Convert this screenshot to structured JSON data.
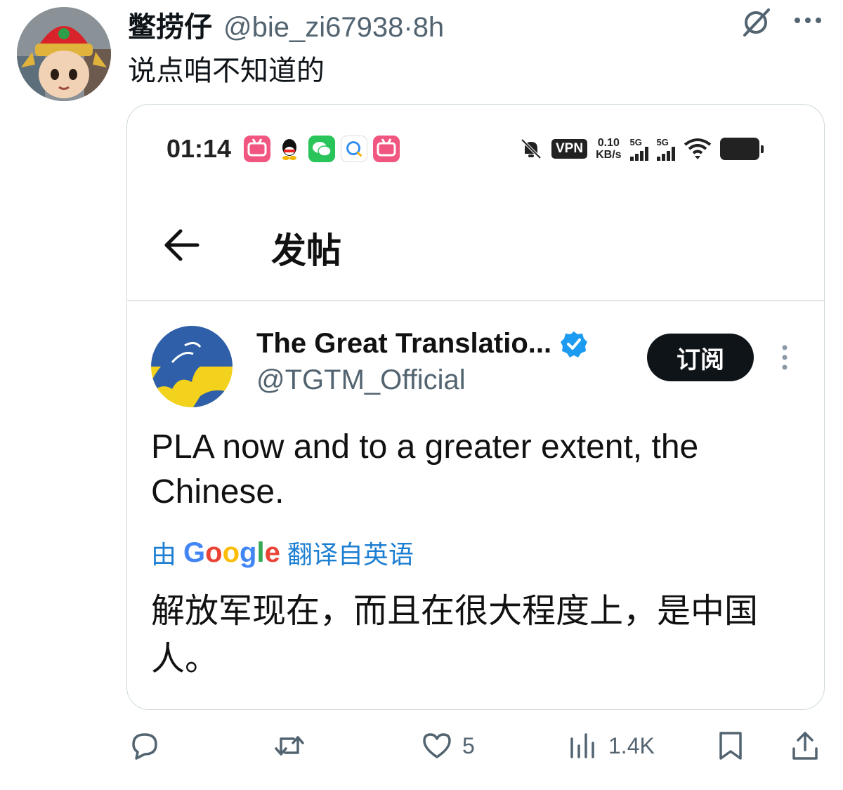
{
  "tweet": {
    "display_name": "鳖捞仔",
    "handle": "@bie_zi67938",
    "separator": "·",
    "time": "8h",
    "text": "说点咱不知道的"
  },
  "media": {
    "status_bar": {
      "time": "01:14",
      "app_icons": [
        "bilibili-icon",
        "qq-icon",
        "wechat-icon",
        "qq-browser-icon",
        "bilibili-icon"
      ],
      "vpn": "VPN",
      "net_speed_value": "0.10",
      "net_speed_unit": "KB/s",
      "signal_1": "5G",
      "signal_2": "5G"
    },
    "page_title": "发帖",
    "post": {
      "display_name": "The Great Translatio...",
      "handle": "@TGTM_Official",
      "subscribe_label": "订阅",
      "text": "PLA now and to a greater extent, the Chinese.",
      "translate_prefix": "由",
      "translate_brand": "Google",
      "translate_suffix": "翻译自英语",
      "translated_text": "解放军现在，而且在很大程度上，是中国人。"
    }
  },
  "actions": {
    "reply_count": "",
    "retweet_count": "",
    "like_count": "5",
    "views_count": "1.4K"
  },
  "colors": {
    "accent_blue": "#1d9bf0",
    "translate_blue": "#1d7fd2",
    "muted_gray": "#536471"
  }
}
